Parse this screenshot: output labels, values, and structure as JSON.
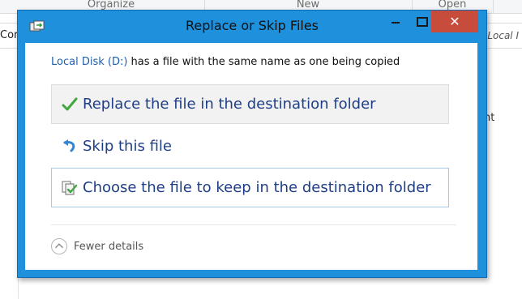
{
  "background": {
    "ribbon_groups": [
      "Organize",
      "New",
      "Open"
    ],
    "address_fragment": "Cor",
    "search_fragment": "Local I",
    "side_fragment": "nt"
  },
  "dialog": {
    "title": "Replace or Skip Files",
    "close_glyph": "✕",
    "message": {
      "source": "Local Disk (D:)",
      "text": " has a file with the same name as one being copied"
    },
    "options": [
      {
        "label": "Replace the file in the destination folder",
        "icon": "check-icon"
      },
      {
        "label": "Skip this file",
        "icon": "skip-arrow-icon"
      },
      {
        "label": "Choose the file to keep in the destination folder",
        "icon": "compare-files-icon"
      }
    ],
    "details_toggle": {
      "label": "Fewer details",
      "icon": "chevron-up-icon"
    }
  },
  "colors": {
    "frame": "#1e90dc",
    "close": "#c74c3c",
    "link": "#1e5fad",
    "option_text": "#1e3e86"
  }
}
